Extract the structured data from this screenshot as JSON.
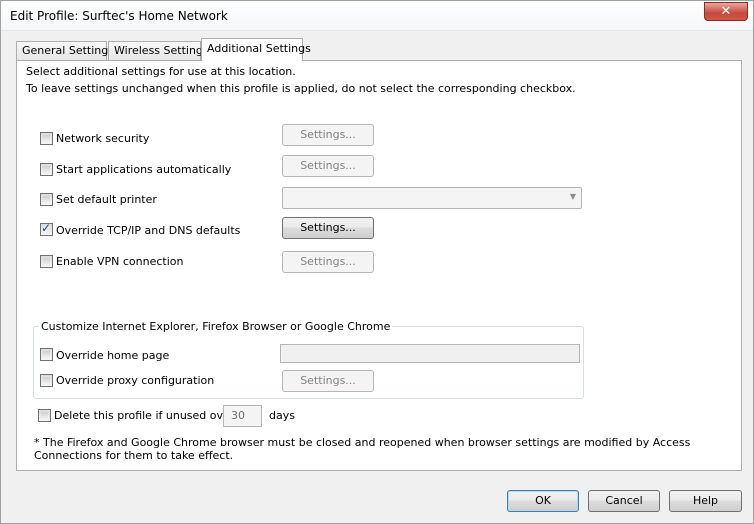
{
  "window": {
    "title": "Edit Profile: Surftec's Home Network",
    "close_label": "✕"
  },
  "tabs": [
    {
      "label": "General Settings"
    },
    {
      "label": "Wireless Settings"
    },
    {
      "label": "Additional Settings",
      "active": true
    }
  ],
  "panel": {
    "intro": "Select additional settings for use at this location.",
    "hint": "To leave settings unchanged when this profile is applied, do not select the corresponding checkbox."
  },
  "options": [
    {
      "label": "Network security",
      "checked": false,
      "button_label": "Settings...",
      "button_enabled": false
    },
    {
      "label": "Start applications automatically",
      "checked": false,
      "button_label": "Settings...",
      "button_enabled": false
    },
    {
      "label": "Set default printer",
      "checked": false,
      "printer_value": ""
    },
    {
      "label": "Override TCP/IP and DNS defaults",
      "checked": true,
      "button_label": "Settings...",
      "button_enabled": true
    },
    {
      "label": "Enable VPN connection",
      "checked": false,
      "button_label": "Settings...",
      "button_enabled": false
    }
  ],
  "browser_group": {
    "legend": "Customize Internet Explorer, Firefox Browser or Google Chrome",
    "home_page": {
      "label": "Override home page",
      "checked": false,
      "value": ""
    },
    "proxy": {
      "label": "Override proxy configuration",
      "checked": false,
      "button_label": "Settings..."
    }
  },
  "delete_profile": {
    "label": "Delete this profile if unused over",
    "checked": false,
    "days_value": "30",
    "days_label": "days"
  },
  "footnote": {
    "line1": "* The Firefox and Google Chrome browser must be closed and reopened when browser settings are modified by Access",
    "line2": "Connections for them to take effect."
  },
  "footer": {
    "ok_label": "OK",
    "cancel_label": "Cancel",
    "help_label": "Help"
  }
}
